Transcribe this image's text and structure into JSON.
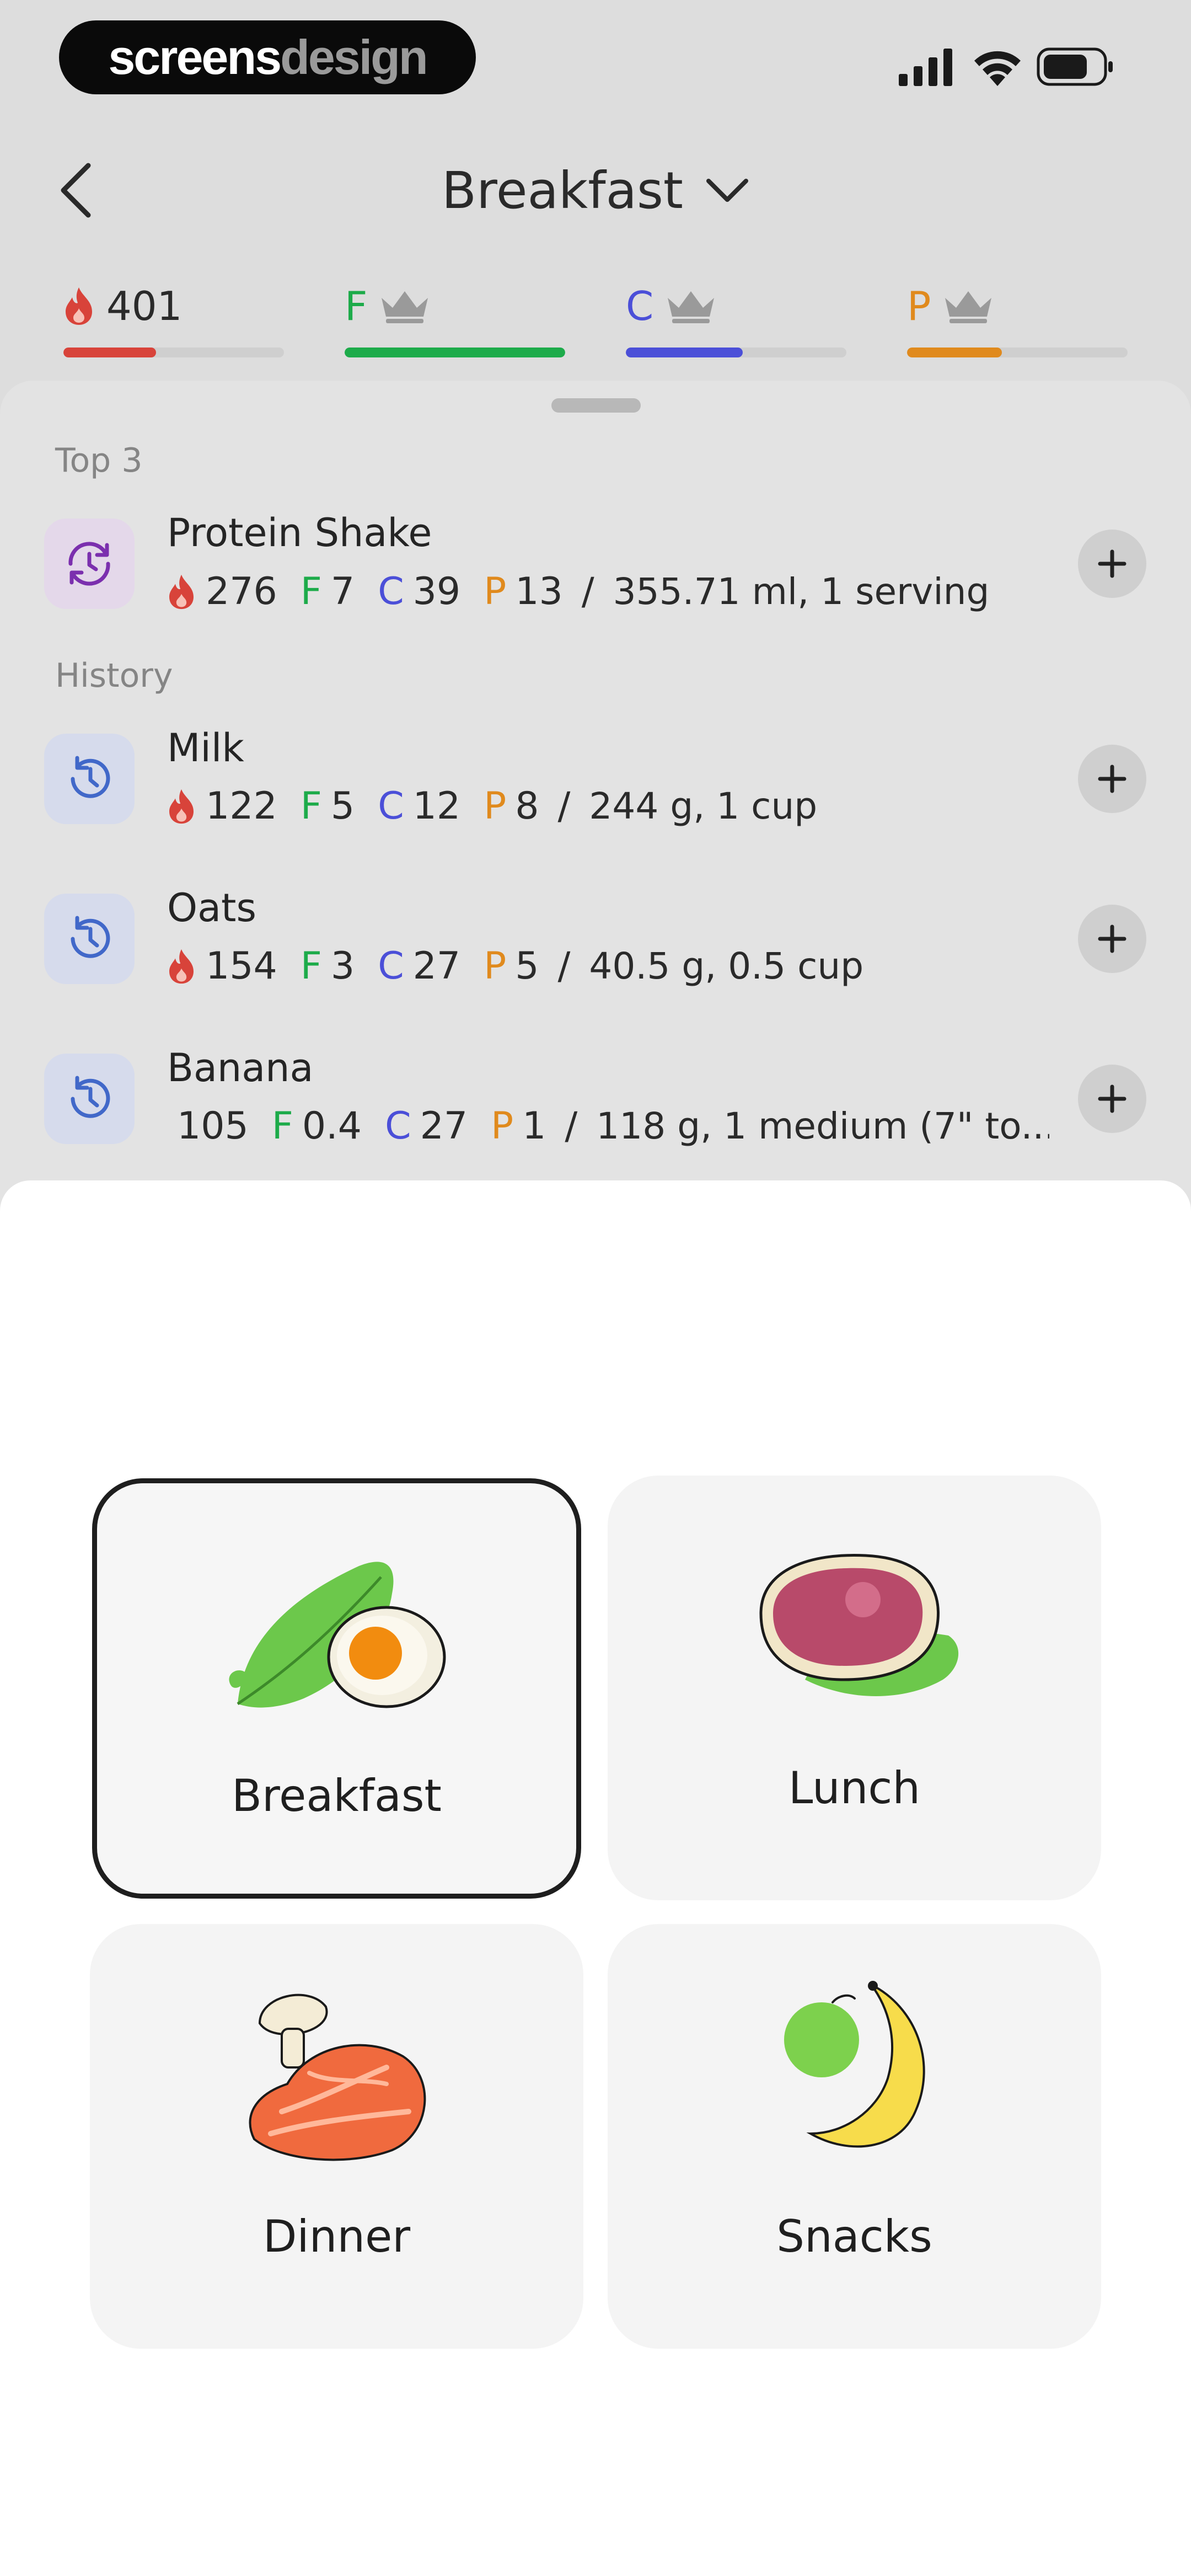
{
  "status_bar": {
    "brand_part1": "screens",
    "brand_part2": "design"
  },
  "header": {
    "title": "Breakfast"
  },
  "macros": {
    "calories": {
      "value": "401",
      "progress": 0.42,
      "color": "#d8433a"
    },
    "fat": {
      "letter": "F",
      "progress": 1.0,
      "color": "#1dab4a"
    },
    "carbs": {
      "letter": "C",
      "progress": 0.53,
      "color": "#4b4fd8"
    },
    "protein": {
      "letter": "P",
      "progress": 0.43,
      "color": "#e08a1d"
    }
  },
  "top3": {
    "label": "Top 3",
    "items": [
      {
        "name": "Protein Shake",
        "kcal": "276",
        "f": "7",
        "c": "39",
        "p": "13",
        "serving": "355.71 ml, 1 serving"
      }
    ]
  },
  "history": {
    "label": "History",
    "items": [
      {
        "name": "Milk",
        "kcal": "122",
        "f": "5",
        "c": "12",
        "p": "8",
        "serving": "244 g, 1 cup"
      },
      {
        "name": "Oats",
        "kcal": "154",
        "f": "3",
        "c": "27",
        "p": "5",
        "serving": "40.5 g, 0.5 cup"
      },
      {
        "name": "Banana",
        "kcal": "105",
        "f": "0.4",
        "c": "27",
        "p": "1",
        "serving": "118 g, 1 medium (7\" to..."
      }
    ]
  },
  "macro_letters": {
    "f": "F",
    "c": "C",
    "p": "P",
    "sep": "/"
  },
  "meals": {
    "selected": "Breakfast",
    "options": [
      "Breakfast",
      "Lunch",
      "Dinner",
      "Snacks"
    ]
  }
}
